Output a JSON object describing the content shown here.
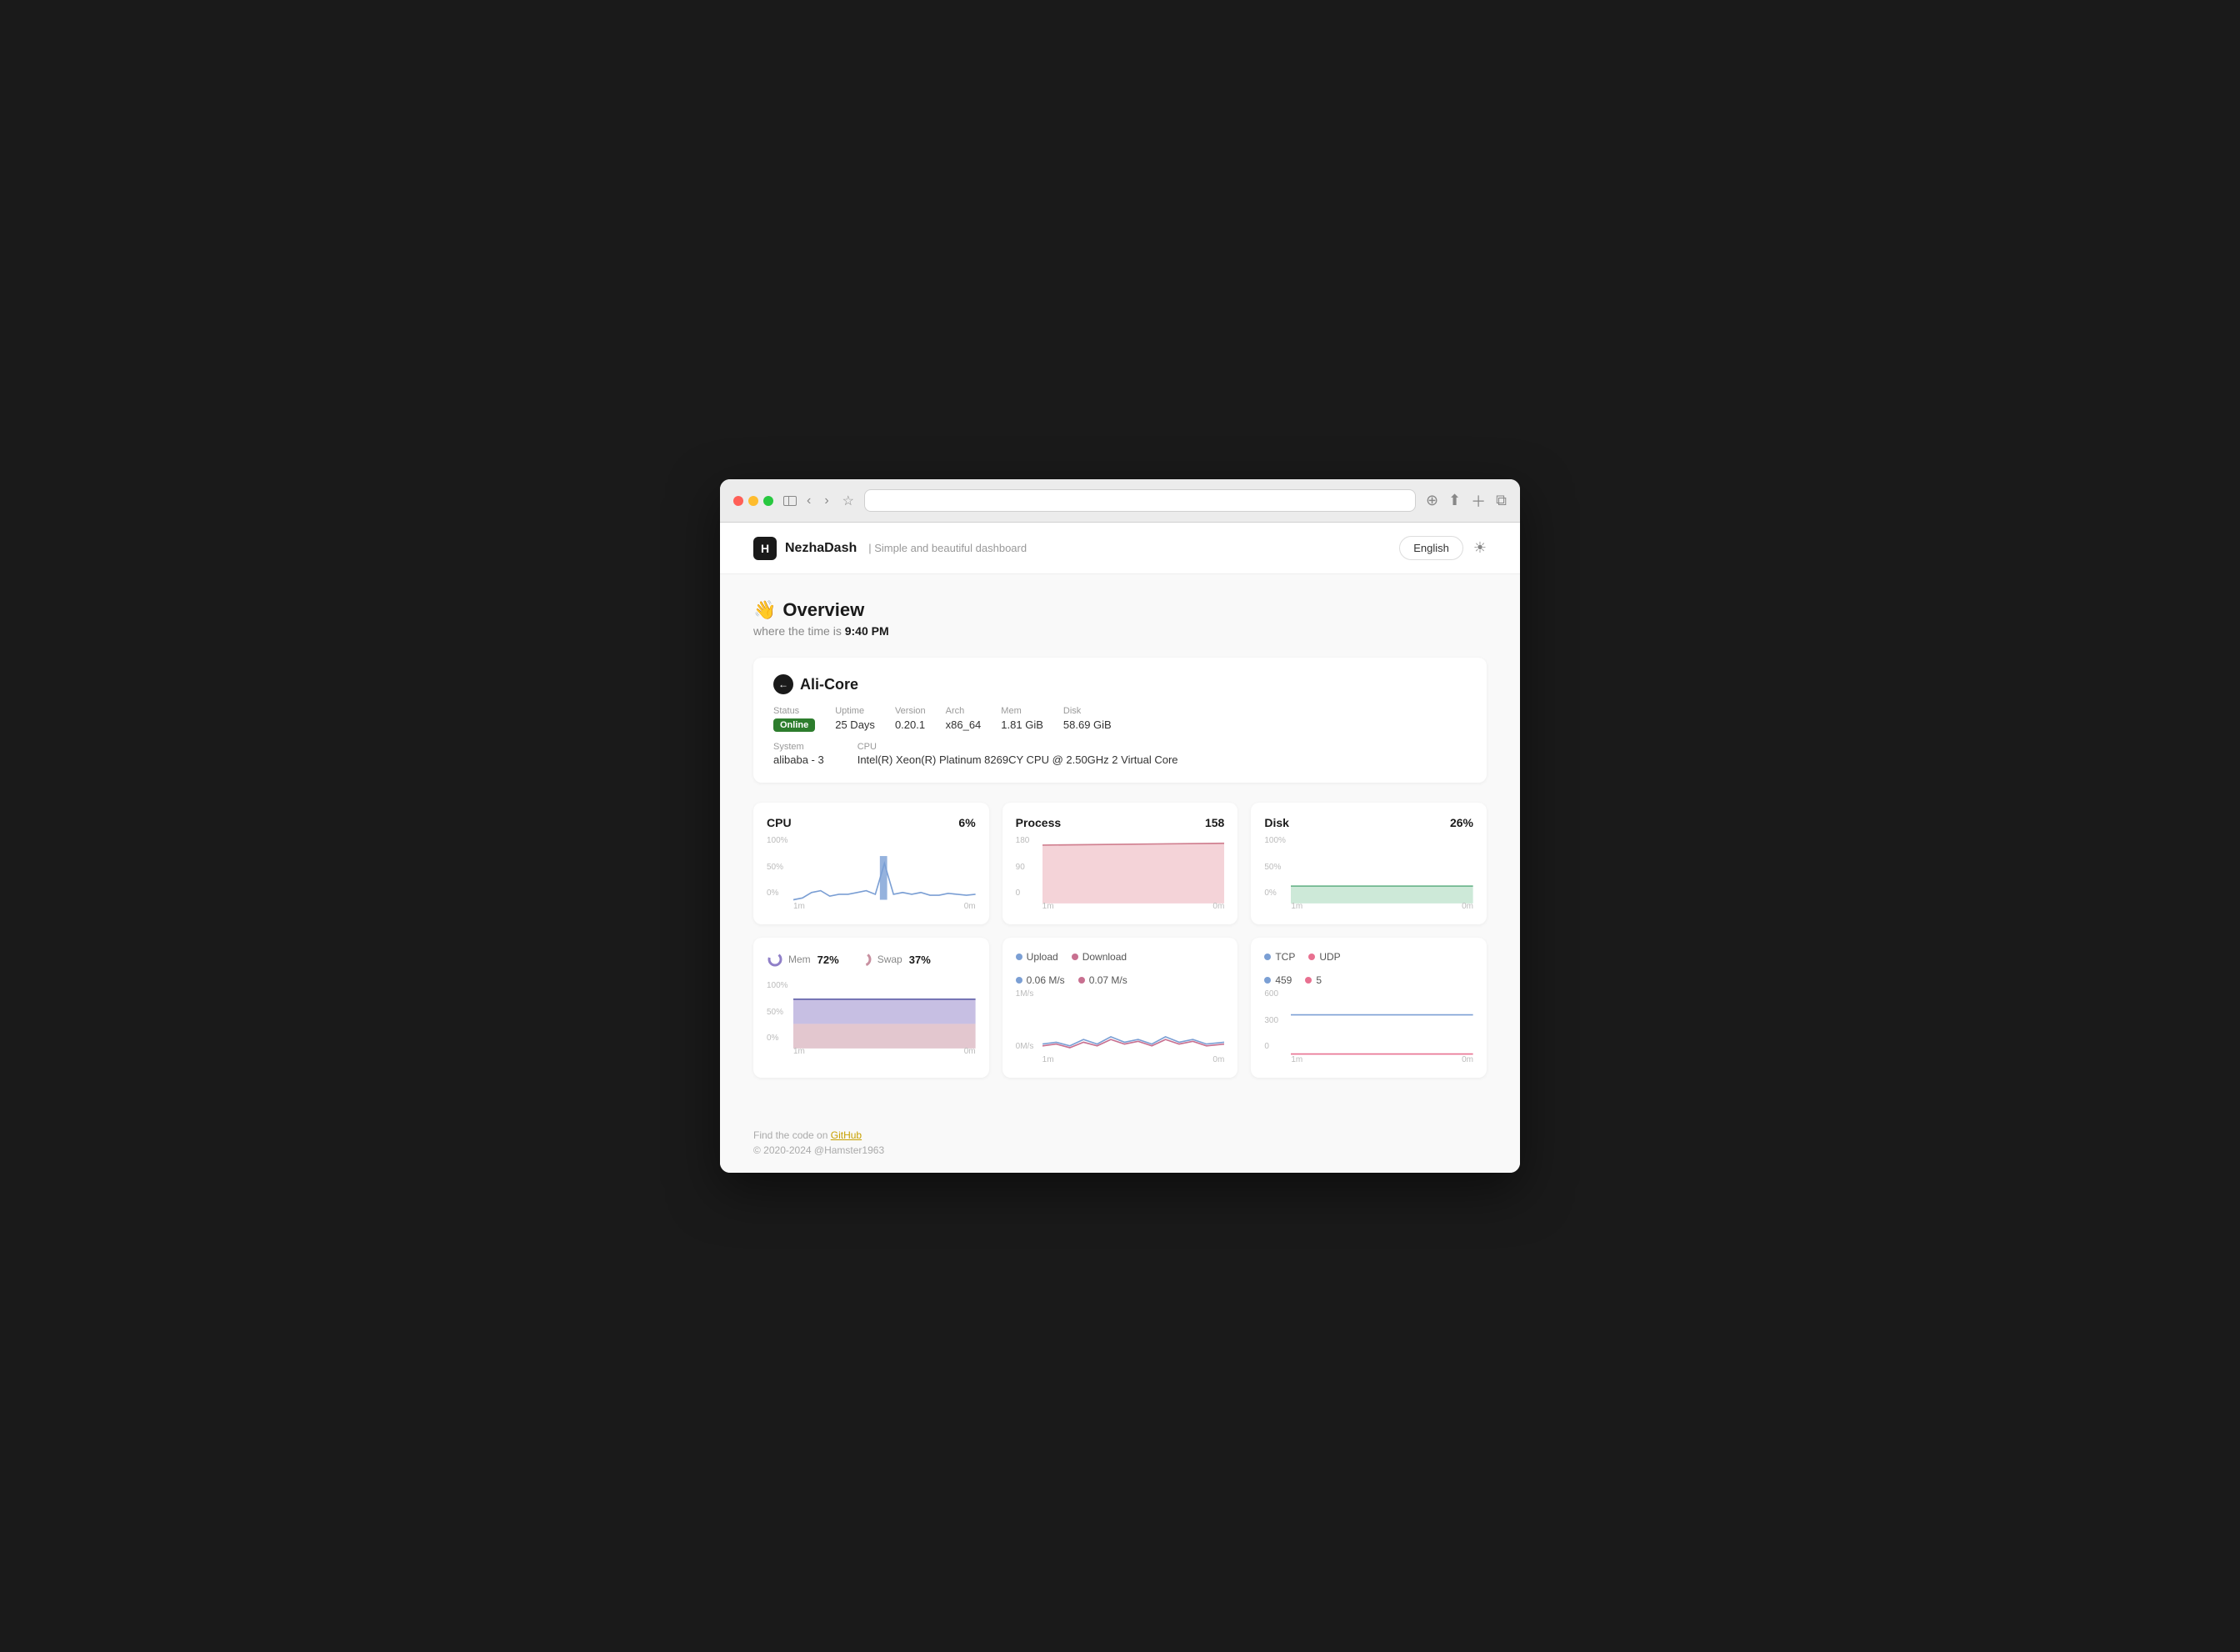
{
  "browser": {
    "address": ""
  },
  "header": {
    "logo_letter": "H",
    "app_name": "NezhaDash",
    "tagline": "Simple and beautiful dashboard",
    "lang_button": "English",
    "theme_icon": "☀"
  },
  "overview": {
    "emoji": "👋",
    "title": "Overview",
    "time_label": "where the time is",
    "time_value": "9:40 PM"
  },
  "server": {
    "icon": "←",
    "name": "Ali-Core",
    "status_label": "Status",
    "status_value": "Online",
    "uptime_label": "Uptime",
    "uptime_value": "25 Days",
    "version_label": "Version",
    "version_value": "0.20.1",
    "arch_label": "Arch",
    "arch_value": "x86_64",
    "mem_label": "Mem",
    "mem_value": "1.81 GiB",
    "disk_label": "Disk",
    "disk_value": "58.69 GiB",
    "system_label": "System",
    "system_value": "alibaba - 3",
    "cpu_label": "CPU",
    "cpu_value": "Intel(R) Xeon(R) Platinum 8269CY CPU @ 2.50GHz 2 Virtual Core"
  },
  "charts": {
    "cpu": {
      "title": "CPU",
      "value": "6%",
      "y_labels": [
        "100%",
        "50%",
        "0%"
      ],
      "x_labels": [
        "1m",
        "0m"
      ],
      "color": "#7b9fd4"
    },
    "process": {
      "title": "Process",
      "value": "158",
      "y_labels": [
        "180",
        "90",
        "0"
      ],
      "x_labels": [
        "1m",
        "0m"
      ],
      "color": "#e8a0a8",
      "fill": "#f0c0c8"
    },
    "disk": {
      "title": "Disk",
      "value": "26%",
      "y_labels": [
        "100%",
        "50%",
        "0%"
      ],
      "x_labels": [
        "1m",
        "0m"
      ],
      "color": "#90c8a8",
      "fill": "#b8e0c8"
    },
    "mem": {
      "title": "Mem",
      "mem_label": "Mem",
      "mem_percent": "72%",
      "swap_label": "Swap",
      "swap_percent": "37%",
      "y_labels": [
        "100%",
        "50%",
        "0%"
      ],
      "x_labels": [
        "1m",
        "0m"
      ],
      "mem_color": "#9080c8",
      "swap_color": "#c890a0"
    },
    "network": {
      "title_upload": "Upload",
      "title_download": "Download",
      "upload_value": "0.06 M/s",
      "download_value": "0.07 M/s",
      "upload_color": "#7b9fd4",
      "download_color": "#c87090",
      "y_labels": [
        "1M/s",
        "0M/s"
      ],
      "x_labels": [
        "1m",
        "0m"
      ]
    },
    "connections": {
      "tcp_label": "TCP",
      "tcp_value": "459",
      "udp_label": "UDP",
      "udp_value": "5",
      "tcp_color": "#7b9fd4",
      "udp_color": "#e87090",
      "y_labels": [
        "600",
        "300",
        "0"
      ],
      "x_labels": [
        "1m",
        "0m"
      ]
    }
  },
  "footer": {
    "text": "Find the code on",
    "link_text": "GitHub",
    "copyright": "© 2020-2024  @Hamster1963"
  }
}
